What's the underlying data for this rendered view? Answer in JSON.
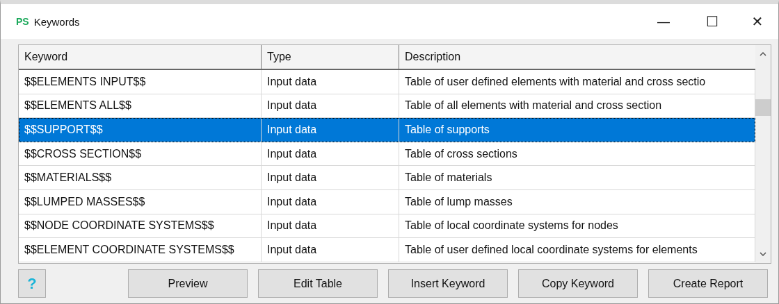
{
  "window": {
    "logo": "PS",
    "title": "Keywords",
    "controls": [
      {
        "kind": "minimize",
        "label": "—"
      },
      {
        "kind": "maximize",
        "label": "☐"
      },
      {
        "kind": "close",
        "label": "✕"
      }
    ]
  },
  "table": {
    "columns": [
      "Keyword",
      "Type",
      "Description"
    ],
    "rows": [
      {
        "keyword": "$$ELEMENTS INPUT$$",
        "type": "Input data",
        "description": "Table of user defined elements with material and cross sectio",
        "selected": false
      },
      {
        "keyword": "$$ELEMENTS ALL$$",
        "type": "Input data",
        "description": "Table of all elements with material and cross section",
        "selected": false
      },
      {
        "keyword": "$$SUPPORT$$",
        "type": "Input data",
        "description": "Table of supports",
        "selected": true
      },
      {
        "keyword": "$$CROSS SECTION$$",
        "type": "Input data",
        "description": "Table of cross sections",
        "selected": false
      },
      {
        "keyword": "$$MATERIALS$$",
        "type": "Input data",
        "description": "Table of materials",
        "selected": false
      },
      {
        "keyword": "$$LUMPED MASSES$$",
        "type": "Input data",
        "description": "Table of lump masses",
        "selected": false
      },
      {
        "keyword": "$$NODE COORDINATE SYSTEMS$$",
        "type": "Input data",
        "description": "Table of local coordinate systems for nodes",
        "selected": false
      },
      {
        "keyword": "$$ELEMENT COORDINATE SYSTEMS$$",
        "type": "Input data",
        "description": "Table of user defined local coordinate systems for elements",
        "selected": false
      }
    ]
  },
  "buttons": [
    {
      "kind": "help",
      "label": "?"
    },
    {
      "kind": "text",
      "label": "Preview"
    },
    {
      "kind": "text",
      "label": "Edit Table"
    },
    {
      "kind": "text",
      "label": "Insert Keyword"
    },
    {
      "kind": "text",
      "label": "Copy Keyword"
    },
    {
      "kind": "text",
      "label": "Create Report"
    }
  ]
}
